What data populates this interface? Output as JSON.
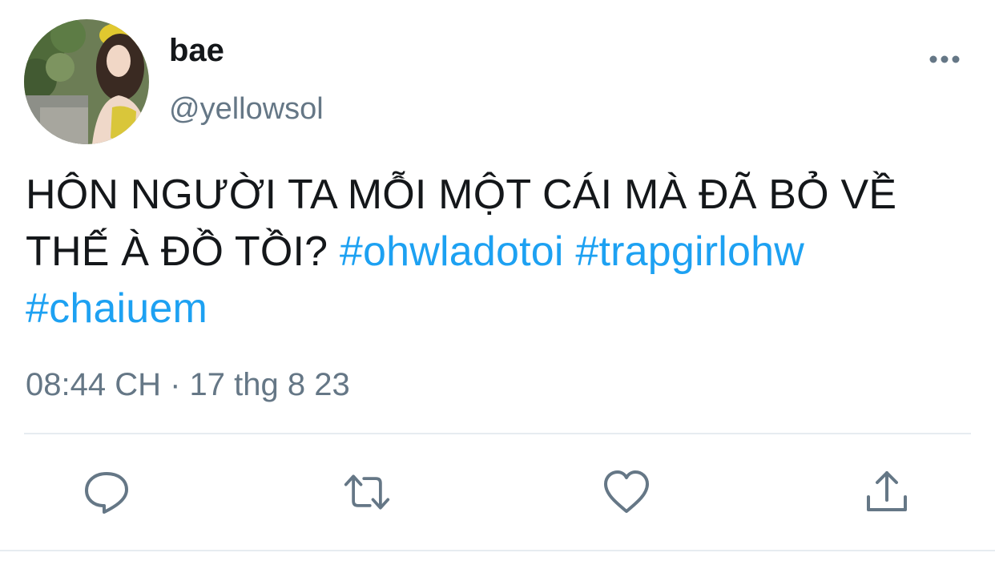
{
  "tweet": {
    "display_name": "bae",
    "handle": "@yellowsol",
    "text_plain": "HÔN NGƯỜI TA MỖI MỘT CÁI MÀ ĐÃ BỎ VỀ THẾ À ĐỒ TỒI? ",
    "hashtags": [
      "#ohwladotoi",
      "#trapgirlohw",
      "#chaiuem"
    ],
    "timestamp": "08:44 CH · 17 thg 8 23"
  },
  "icons": {
    "more": "more-horizontal-icon",
    "reply": "reply-icon",
    "retweet": "retweet-icon",
    "like": "heart-icon",
    "share": "share-icon"
  },
  "colors": {
    "text": "#14171a",
    "secondary": "#657786",
    "accent": "#1da1f2",
    "divider": "#e6ecf0"
  }
}
